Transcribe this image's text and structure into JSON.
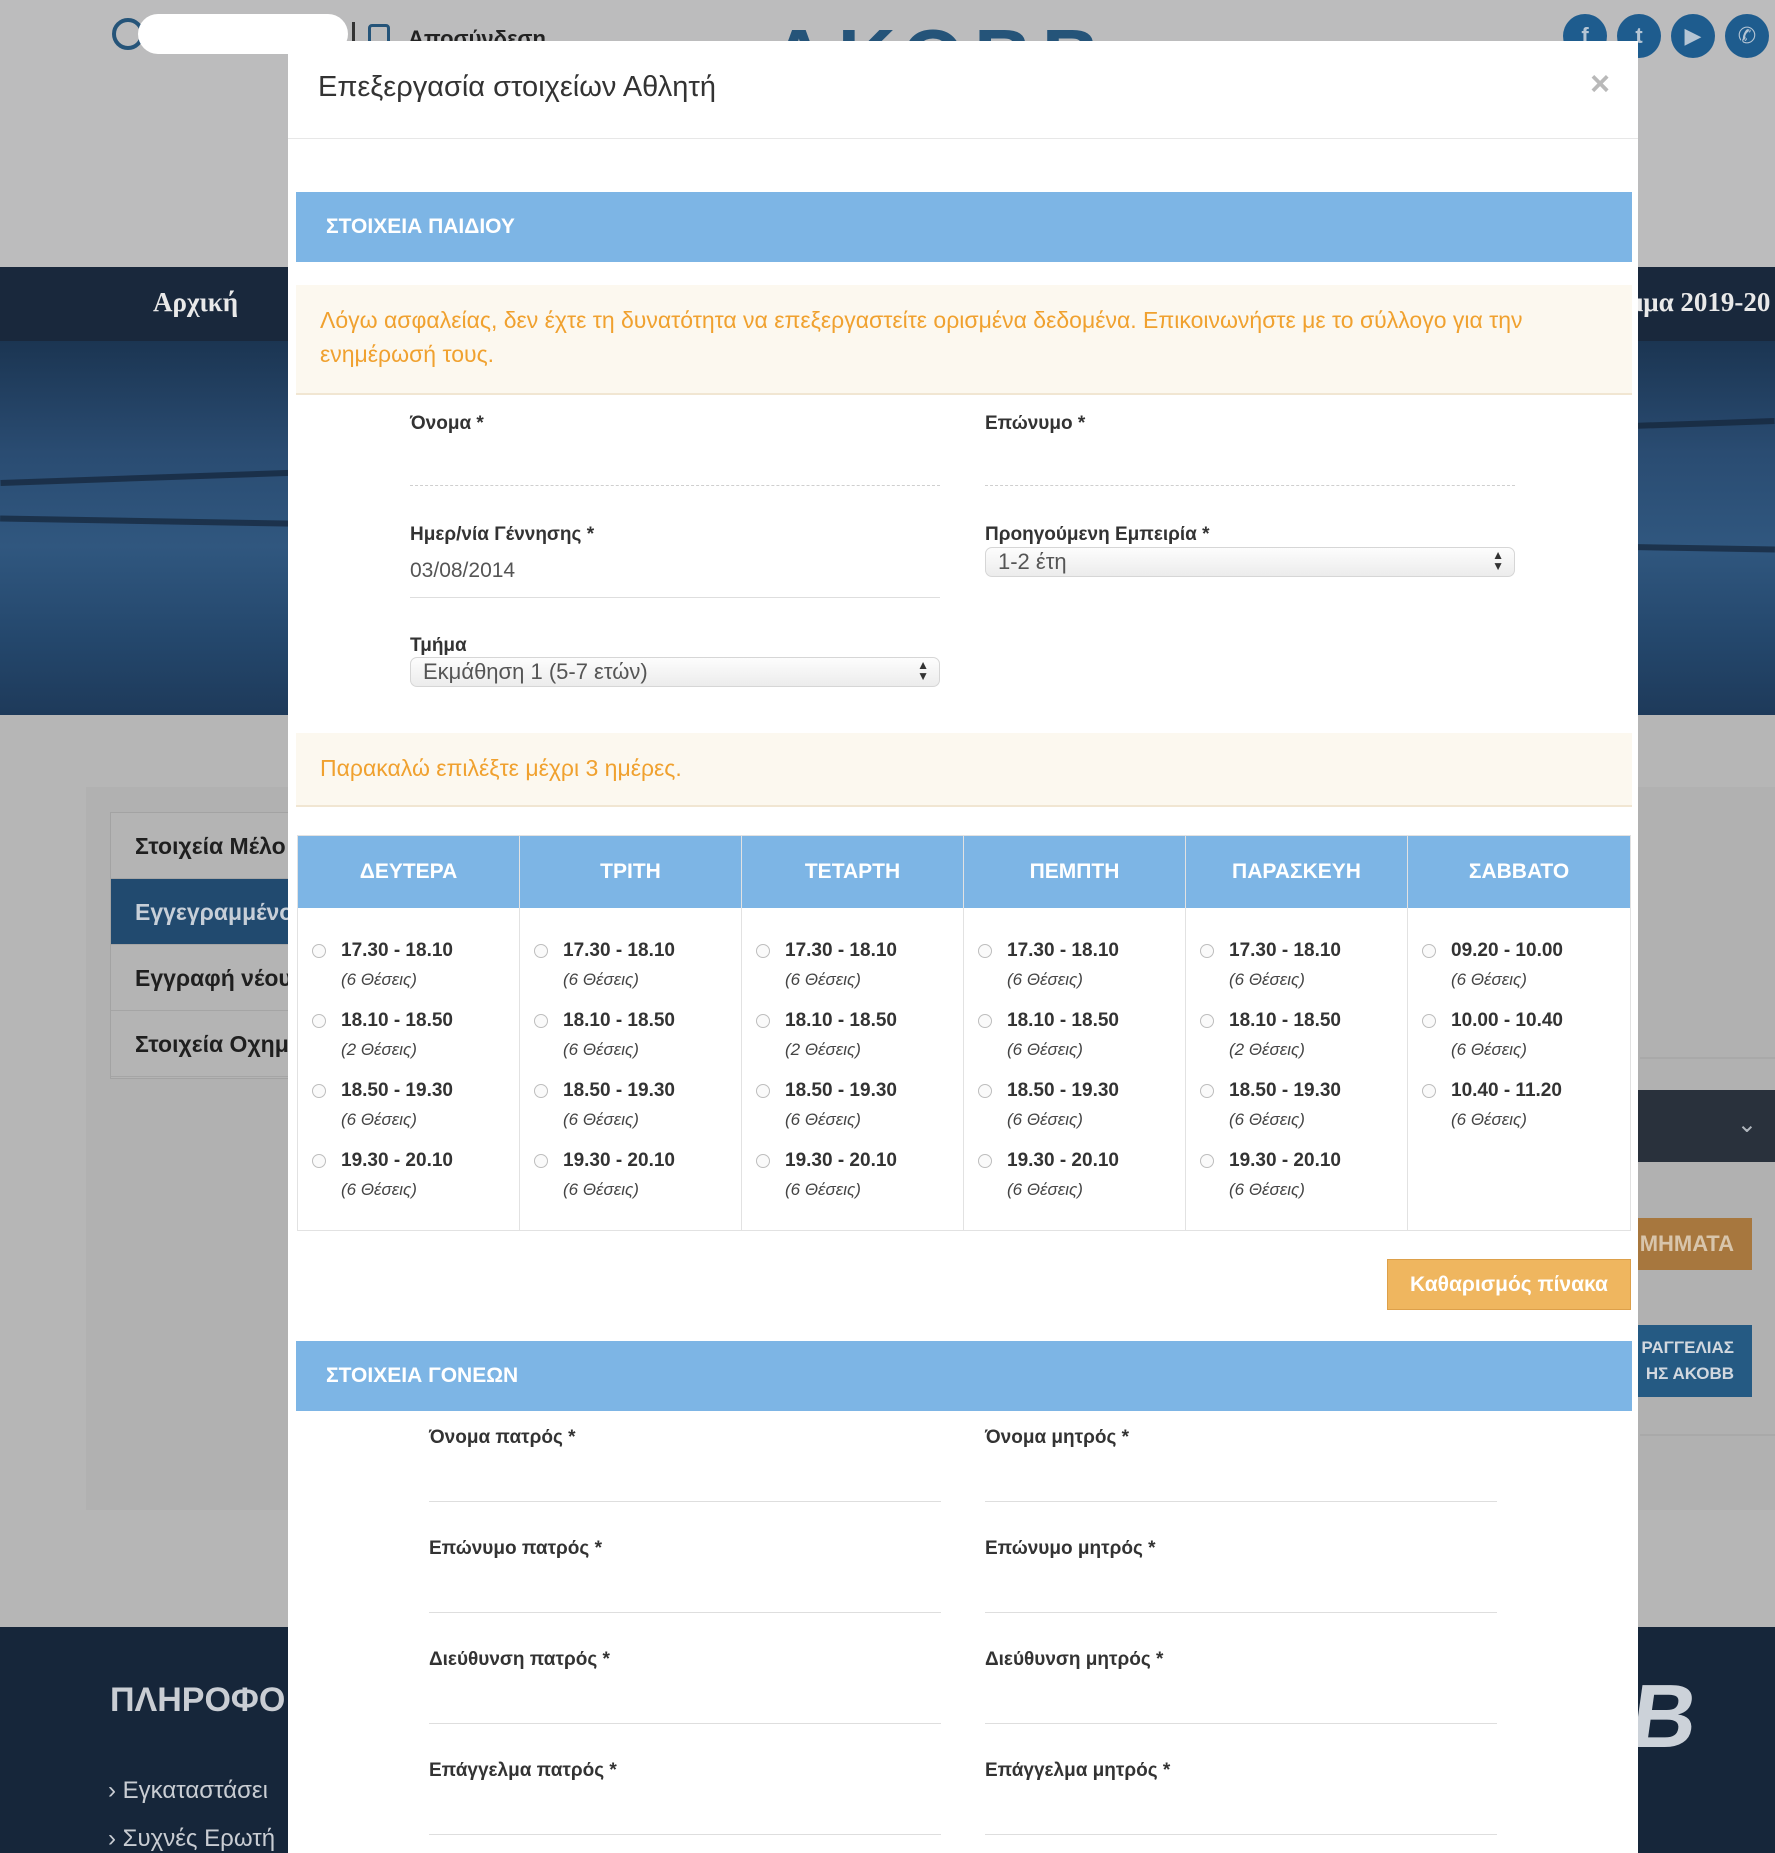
{
  "background": {
    "logout_label": "Αποσύνδεση",
    "logo_text": "ΑΚΟΒΒ",
    "nav": {
      "home": "Αρχική",
      "program": "μμα 2019-20"
    },
    "side_menu": [
      "Στοιχεία Μέλο",
      "Εγγεγραμμένο",
      "Εγγραφή νέου",
      "Στοιχεία Οχημ"
    ],
    "right_button_1": "ΜΗΜΑΤΑ",
    "right_button_2_line1": "ΡΑΓΓΕΛΙΑΣ",
    "right_button_2_line2": "ΗΣ ΑΚΟΒΒ",
    "footer_heading": "ΠΛΗΡΟΦΟ",
    "footer_links": [
      "Εγκαταστάσει",
      "Συχνές Ερωτή"
    ],
    "social_icons": [
      "facebook-icon",
      "twitter-icon",
      "youtube-icon",
      "viber-icon"
    ],
    "footer_logo_fragment": "B"
  },
  "modal": {
    "title": "Επεξεργασία στοιχείων Αθλητή",
    "close_label": "×",
    "child_section": {
      "heading": "ΣΤΟΙΧΕΙΑ ΠΑΙΔΙΟΥ",
      "security_notice": "Λόγω ασφαλείας, δεν έχτε τη δυνατότητα να επεξεργαστείτε ορισμένα δεδομένα. Επικοινωνήστε με το σύλλογο για την ενημέρωσή τους.",
      "first_name_label": "Όνομα *",
      "first_name_value": "",
      "last_name_label": "Επώνυμο *",
      "last_name_value": "",
      "birth_date_label": "Ημερ/νία Γέννησης *",
      "birth_date_value": "03/08/2014",
      "experience_label": "Προηγούμενη Εμπειρία *",
      "experience_value": "1-2 έτη",
      "department_label": "Τμήμα",
      "department_value": "Εκμάθηση 1 (5-7 ετών)"
    },
    "days_notice": "Παρακαλώ επιλέξτε μέχρι 3 ημέρες.",
    "schedule": [
      {
        "day": "ΔΕΥΤΕΡΑ",
        "slots": [
          {
            "time": "17.30 - 18.10",
            "seats": "(6 Θέσεις)"
          },
          {
            "time": "18.10 - 18.50",
            "seats": "(2 Θέσεις)"
          },
          {
            "time": "18.50 - 19.30",
            "seats": "(6 Θέσεις)"
          },
          {
            "time": "19.30 - 20.10",
            "seats": "(6 Θέσεις)"
          }
        ]
      },
      {
        "day": "ΤΡΙΤΗ",
        "slots": [
          {
            "time": "17.30 - 18.10",
            "seats": "(6 Θέσεις)"
          },
          {
            "time": "18.10 - 18.50",
            "seats": "(6 Θέσεις)"
          },
          {
            "time": "18.50 - 19.30",
            "seats": "(6 Θέσεις)"
          },
          {
            "time": "19.30 - 20.10",
            "seats": "(6 Θέσεις)"
          }
        ]
      },
      {
        "day": "ΤΕΤΑΡΤΗ",
        "slots": [
          {
            "time": "17.30 - 18.10",
            "seats": "(6 Θέσεις)"
          },
          {
            "time": "18.10 - 18.50",
            "seats": "(2 Θέσεις)"
          },
          {
            "time": "18.50 - 19.30",
            "seats": "(6 Θέσεις)"
          },
          {
            "time": "19.30 - 20.10",
            "seats": "(6 Θέσεις)"
          }
        ]
      },
      {
        "day": "ΠΕΜΠΤΗ",
        "slots": [
          {
            "time": "17.30 - 18.10",
            "seats": "(6 Θέσεις)"
          },
          {
            "time": "18.10 - 18.50",
            "seats": "(6 Θέσεις)"
          },
          {
            "time": "18.50 - 19.30",
            "seats": "(6 Θέσεις)"
          },
          {
            "time": "19.30 - 20.10",
            "seats": "(6 Θέσεις)"
          }
        ]
      },
      {
        "day": "ΠΑΡΑΣΚΕΥΗ",
        "slots": [
          {
            "time": "17.30 - 18.10",
            "seats": "(6 Θέσεις)"
          },
          {
            "time": "18.10 - 18.50",
            "seats": "(2 Θέσεις)"
          },
          {
            "time": "18.50 - 19.30",
            "seats": "(6 Θέσεις)"
          },
          {
            "time": "19.30 - 20.10",
            "seats": "(6 Θέσεις)"
          }
        ]
      },
      {
        "day": "ΣΑΒΒΑΤΟ",
        "slots": [
          {
            "time": "09.20 - 10.00",
            "seats": "(6 Θέσεις)"
          },
          {
            "time": "10.00 - 10.40",
            "seats": "(6 Θέσεις)"
          },
          {
            "time": "10.40 - 11.20",
            "seats": "(6 Θέσεις)"
          }
        ]
      }
    ],
    "clear_button_label": "Καθαρισμός πίνακα",
    "parents_section": {
      "heading": "ΣΤΟΙΧΕΙΑ ΓΟΝΕΩΝ",
      "father_first_name_label": "Όνομα πατρός *",
      "mother_first_name_label": "Όνομα μητρός *",
      "father_last_name_label": "Επώνυμο πατρός *",
      "mother_last_name_label": "Επώνυμο μητρός *",
      "father_address_label": "Διεύθυνση πατρός *",
      "mother_address_label": "Διεύθυνση μητρός *",
      "father_job_label": "Επάγγελμα πατρός *",
      "mother_job_label": "Επάγγελμα μητρός *"
    }
  }
}
